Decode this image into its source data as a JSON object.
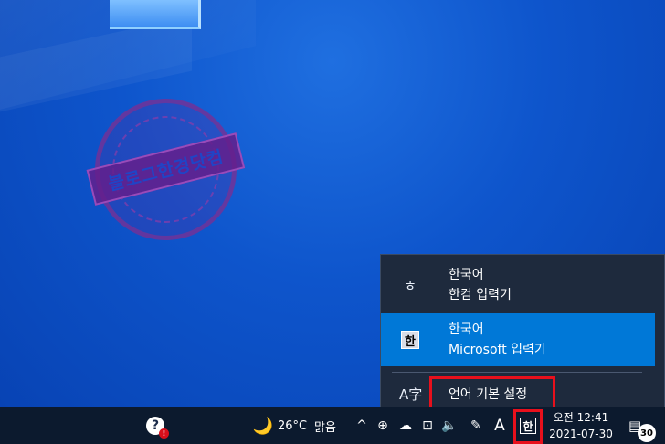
{
  "watermark": {
    "text": "블로그한경닷컴"
  },
  "language_flyout": {
    "items": [
      {
        "icon": "hangul-ieung-icon",
        "glyph": "ㅎ",
        "language": "한국어",
        "ime": "한컴 입력기",
        "selected": false
      },
      {
        "icon": "han-ime-icon",
        "glyph": "한",
        "language": "한국어",
        "ime": "Microsoft 입력기",
        "selected": true
      }
    ],
    "preferences": {
      "icon": "language-settings-icon",
      "glyph": "A字",
      "label": "언어 기본 설정"
    },
    "highlight_color": "#0078d7",
    "background_color": "#1e2a3d"
  },
  "taskbar": {
    "help": {
      "icon": "help-icon",
      "glyph": "?",
      "badge": "!"
    },
    "weather": {
      "icon": "moon-icon",
      "glyph": "🌙",
      "temperature": "26°C",
      "condition": "맑음"
    },
    "tray": {
      "chevron": "^",
      "meet_now": "⊕",
      "onedrive": "☁",
      "network": "⊡",
      "volume": "🔈",
      "pen": "✎",
      "ime_mode": "A",
      "ime_lang": "한"
    },
    "clock": {
      "time": "오전 12:41",
      "date": "2021-07-30"
    },
    "notifications": {
      "icon": "notification-icon",
      "glyph": "▤",
      "count": "30"
    }
  },
  "colors": {
    "annotation_red": "#e8101c",
    "taskbar": "#0c1a2e"
  }
}
